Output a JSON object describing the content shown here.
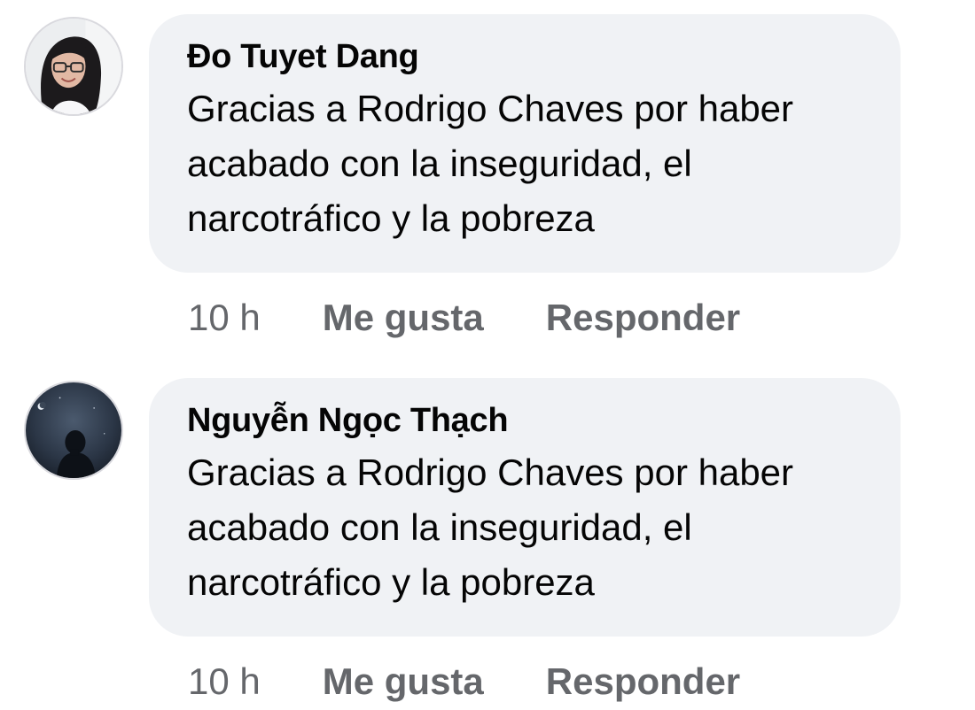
{
  "comments": [
    {
      "author": "Đo Tuyet Dang",
      "text": "Gracias a Rodrigo Chaves por haber\nacabado con la inseguridad, el\nnarcotráfico y la pobreza",
      "time": "10 h",
      "like_label": "Me gusta",
      "reply_label": "Responder",
      "avatar_icon": "profile-photo-woman-glasses"
    },
    {
      "author": "Nguyễn Ngọc Thạch",
      "text": "Gracias a Rodrigo Chaves por haber\nacabado con la inseguridad, el\nnarcotráfico y la pobreza",
      "time": "10 h",
      "like_label": "Me gusta",
      "reply_label": "Responder",
      "avatar_icon": "profile-photo-night-silhouette"
    }
  ],
  "colors": {
    "bubble_bg": "#f0f2f5",
    "text": "#050505",
    "secondary": "#65676b"
  }
}
